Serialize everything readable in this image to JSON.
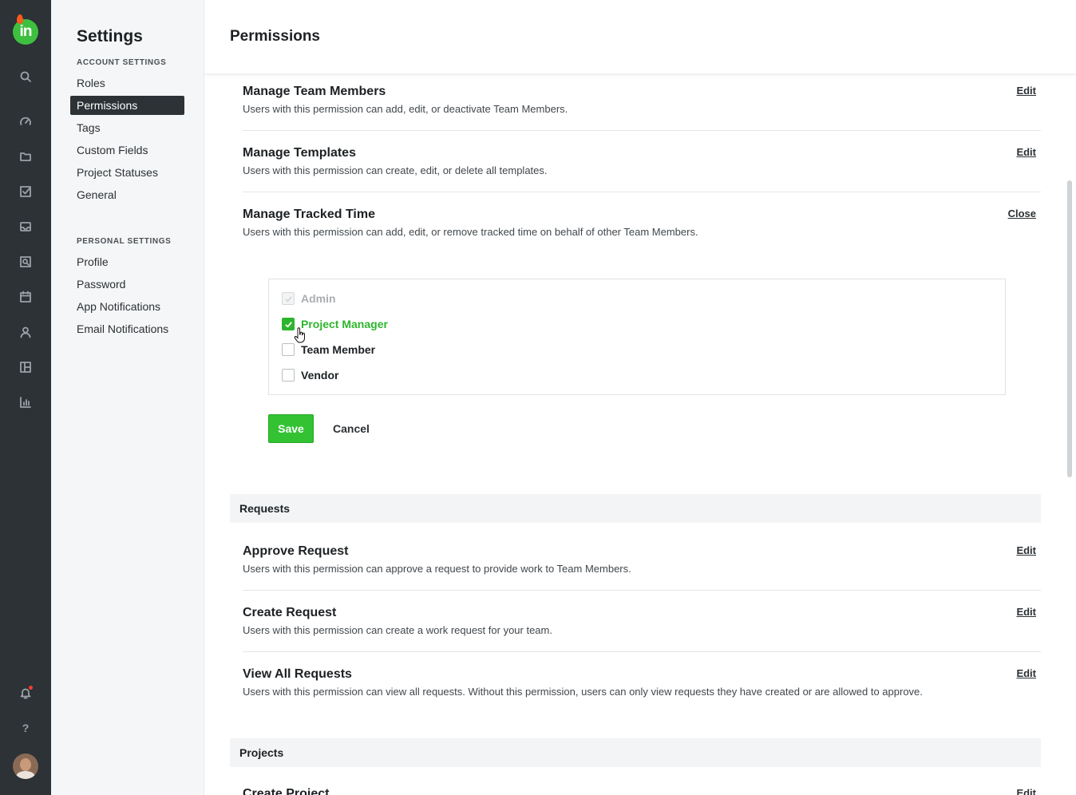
{
  "app": {
    "logo_text": "in",
    "rail_icons": [
      "search-icon",
      "dashboard-icon",
      "folder-icon",
      "tasks-icon",
      "inbox-icon",
      "reports-search-icon",
      "calendar-icon",
      "people-icon",
      "layout-icon",
      "bar-chart-icon",
      "notification-bell-icon",
      "help-icon"
    ]
  },
  "settings": {
    "title": "Settings",
    "account_heading": "ACCOUNT SETTINGS",
    "account_items": [
      "Roles",
      "Permissions",
      "Tags",
      "Custom Fields",
      "Project Statuses",
      "General"
    ],
    "personal_heading": "PERSONAL SETTINGS",
    "personal_items": [
      "Profile",
      "Password",
      "App Notifications",
      "Email Notifications"
    ]
  },
  "main": {
    "title": "Permissions",
    "permissions_top": [
      {
        "title": "Manage Team Members",
        "desc": "Users with this permission can add, edit, or deactivate Team Members.",
        "action": "Edit"
      },
      {
        "title": "Manage Templates",
        "desc": "Users with this permission can create, edit, or delete all templates.",
        "action": "Edit"
      },
      {
        "title": "Manage Tracked Time",
        "desc": "Users with this permission can add, edit, or remove tracked time on behalf of other Team Members.",
        "action": "Close"
      }
    ],
    "roles": [
      {
        "label": "Admin",
        "checked": true,
        "disabled": true
      },
      {
        "label": "Project Manager",
        "checked": true,
        "disabled": false
      },
      {
        "label": "Team Member",
        "checked": false,
        "disabled": false
      },
      {
        "label": "Vendor",
        "checked": false,
        "disabled": false
      }
    ],
    "save_label": "Save",
    "cancel_label": "Cancel",
    "requests_section": "Requests",
    "permissions_requests": [
      {
        "title": "Approve Request",
        "desc": "Users with this permission can approve a request to provide work to Team Members.",
        "action": "Edit"
      },
      {
        "title": "Create Request",
        "desc": "Users with this permission can create a work request for your team.",
        "action": "Edit"
      },
      {
        "title": "View All Requests",
        "desc": "Users with this permission can view all requests. Without this permission, users can only view requests they have created or are allowed to approve.",
        "action": "Edit"
      }
    ],
    "projects_section": "Projects",
    "permissions_projects": [
      {
        "title": "Create Project",
        "action": "Edit"
      }
    ]
  },
  "colors": {
    "rail_bg": "#2c3236",
    "accent_green": "#32c232",
    "nav_active_bg": "#2c3236",
    "notification_dot": "#ff3b30"
  }
}
